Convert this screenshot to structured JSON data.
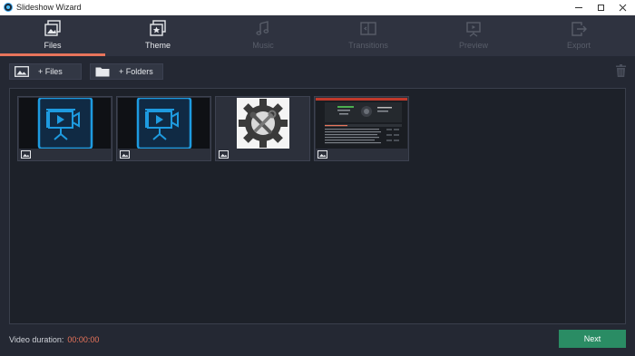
{
  "window": {
    "title": "Slideshow Wizard",
    "icons": {
      "app": "slideshow-app-icon",
      "minimize": "minimize-icon",
      "maximize": "maximize-icon",
      "close": "close-icon"
    }
  },
  "tabs": [
    {
      "label": "Files",
      "icon": "files-icon",
      "state": "active"
    },
    {
      "label": "Theme",
      "icon": "theme-star-icon",
      "state": "enabled"
    },
    {
      "label": "Music",
      "icon": "music-note-icon",
      "state": "disabled"
    },
    {
      "label": "Transitions",
      "icon": "transitions-icon",
      "state": "disabled"
    },
    {
      "label": "Preview",
      "icon": "preview-easel-icon",
      "state": "disabled"
    },
    {
      "label": "Export",
      "icon": "export-icon",
      "state": "disabled"
    }
  ],
  "toolbar": {
    "add_files_label": "+ Files",
    "add_folders_label": "+ Folders",
    "trash_icon": "trash-icon"
  },
  "media": [
    {
      "kind": "video",
      "icon": "video-presentation-icon"
    },
    {
      "kind": "video",
      "icon": "video-presentation-icon"
    },
    {
      "kind": "image",
      "icon": "gear-tools-icon"
    },
    {
      "kind": "image",
      "icon": "screenshot-thumbnail"
    }
  ],
  "footer": {
    "duration_label": "Video duration:",
    "duration_value": "00:00:00",
    "next_label": "Next"
  },
  "colors": {
    "accent": "#e8745b",
    "next_button": "#2a8c64",
    "video_icon": "#1e9be0",
    "background": "#242833",
    "tabbar": "#2f3340"
  }
}
